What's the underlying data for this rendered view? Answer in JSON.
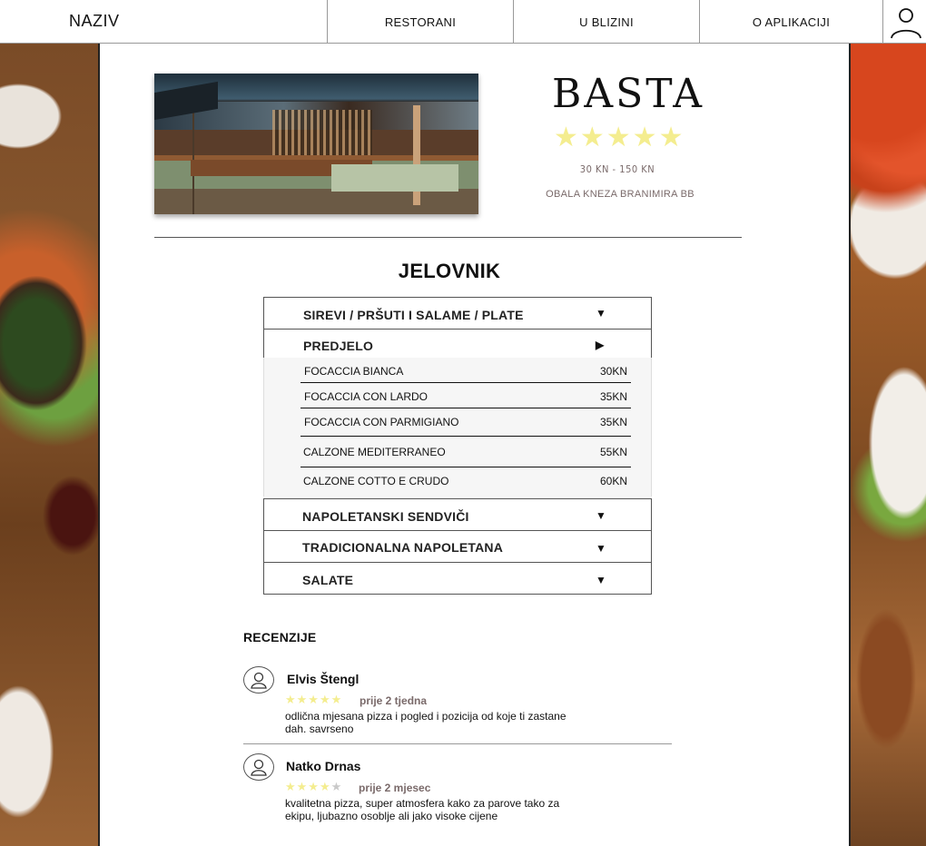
{
  "nav": {
    "brand": "NAZIV",
    "items": [
      "RESTORANI",
      "U BLIZINI",
      "O APLIKACIJI"
    ],
    "user_icon": "user-icon"
  },
  "restaurant": {
    "name": "BASTA",
    "rating_stars": "★★★★★",
    "rating": 5,
    "price_range": "30 KN - 150 KN",
    "address": "OBALA KNEZA BRANIMIRA BB"
  },
  "menu": {
    "title": "JELOVNIK",
    "categories": [
      {
        "label": "SIREVI / PRŠUTI I SALAME / PLATE",
        "arrow": "▼"
      },
      {
        "label": "PREDJELO",
        "arrow": "▶"
      },
      {
        "label": "NAPOLETANSKI SENDVIČI",
        "arrow": "▼"
      },
      {
        "label": "TRADICIONALNA NAPOLETANA",
        "arrow": "▼"
      },
      {
        "label": "SALATE",
        "arrow": "▼"
      }
    ],
    "items": [
      {
        "name": "FOCACCIA BIANCA",
        "price": "30KN"
      },
      {
        "name": "FOCACCIA CON LARDO",
        "price": "35KN"
      },
      {
        "name": "FOCACCIA CON PARMIGIANO",
        "price": "35KN"
      },
      {
        "name": "CALZONE MEDITERRANEO",
        "price": "55KN"
      },
      {
        "name": "CALZONE COTTO E CRUDO",
        "price": "60KN"
      }
    ]
  },
  "reviews": {
    "title": "RECENZIJE",
    "list": [
      {
        "name": "Elvis Štengl",
        "stars_on": "★★★★★",
        "stars_off": "",
        "rating": 5,
        "time": "prije 2 tjedna",
        "text": "odlična mjesana pizza i pogled i pozicija od koje ti zastane dah. savrseno"
      },
      {
        "name": "Natko Drnas",
        "stars_on": "★★★★",
        "stars_off": "★",
        "rating": 4,
        "time": "prije 2 mjesec",
        "text": "kvalitetna pizza, super atmosfera kako za parove tako za ekipu, ljubazno osoblje ali jako visoke cijene"
      }
    ]
  },
  "colors": {
    "star": "#f4ed8f",
    "muted_text": "#7a6a6a"
  }
}
